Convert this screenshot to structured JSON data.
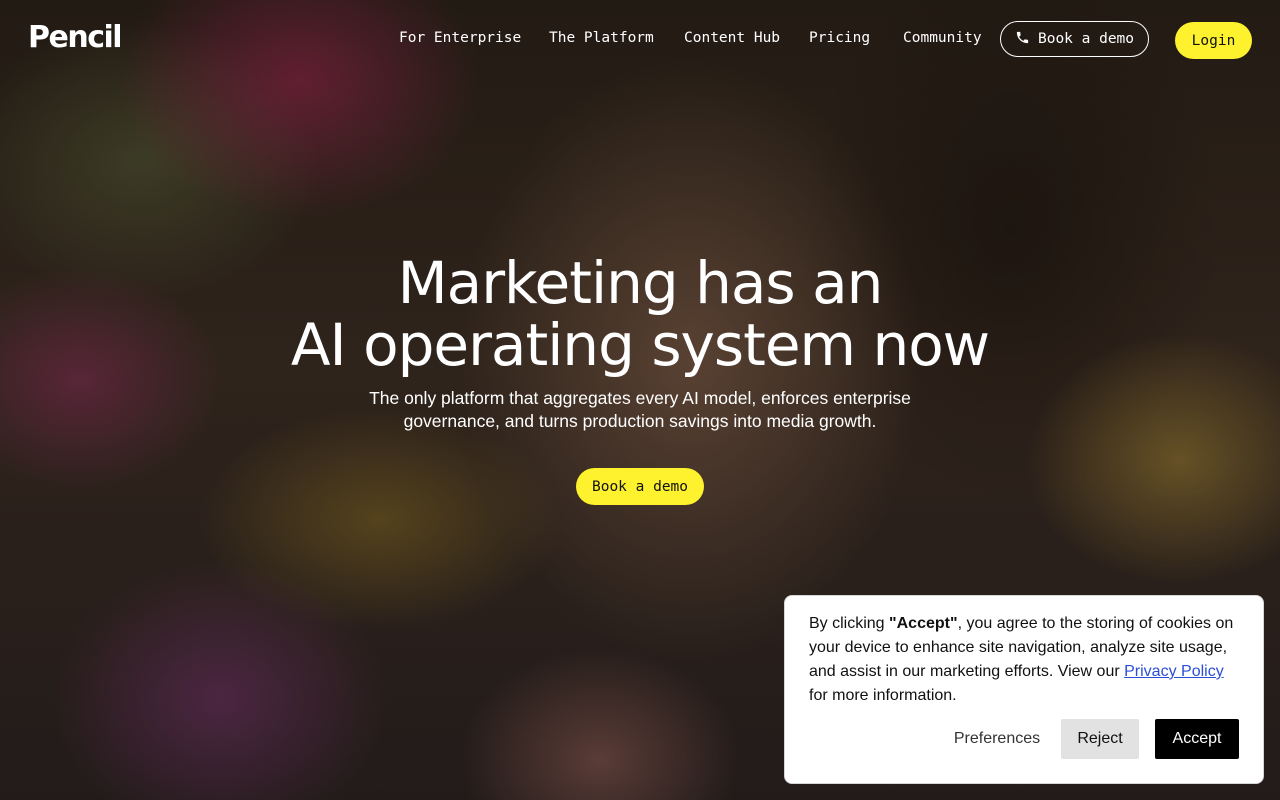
{
  "nav": {
    "logo": "Pencil",
    "links": [
      "For Enterprise",
      "The Platform",
      "Content Hub",
      "Pricing",
      "Community"
    ],
    "demo_label": "Book a demo",
    "demo_icon": "phone-icon",
    "login_label": "Login"
  },
  "hero": {
    "title_lines": [
      "Marketing has an",
      "AI operating system now"
    ],
    "subtitle_lines": [
      "The only platform that aggregates every AI model, enforces enterprise",
      "governance, and turns production savings into media growth."
    ],
    "cta_label": "Book a demo"
  },
  "cookie": {
    "text_before": "By clicking ",
    "text_strong": "\"Accept\"",
    "text_middle": ", you agree to the storing of cookies on your device to enhance site navigation, analyze site usage, and assist in our marketing efforts. View our ",
    "link_label": "Privacy Policy",
    "text_after": " for more information.",
    "preferences_label": "Preferences",
    "reject_label": "Reject",
    "accept_label": "Accept"
  },
  "colors": {
    "accent_yellow": "#fdf22d",
    "link_blue": "#2a4fd6",
    "accept_black": "#000000"
  }
}
